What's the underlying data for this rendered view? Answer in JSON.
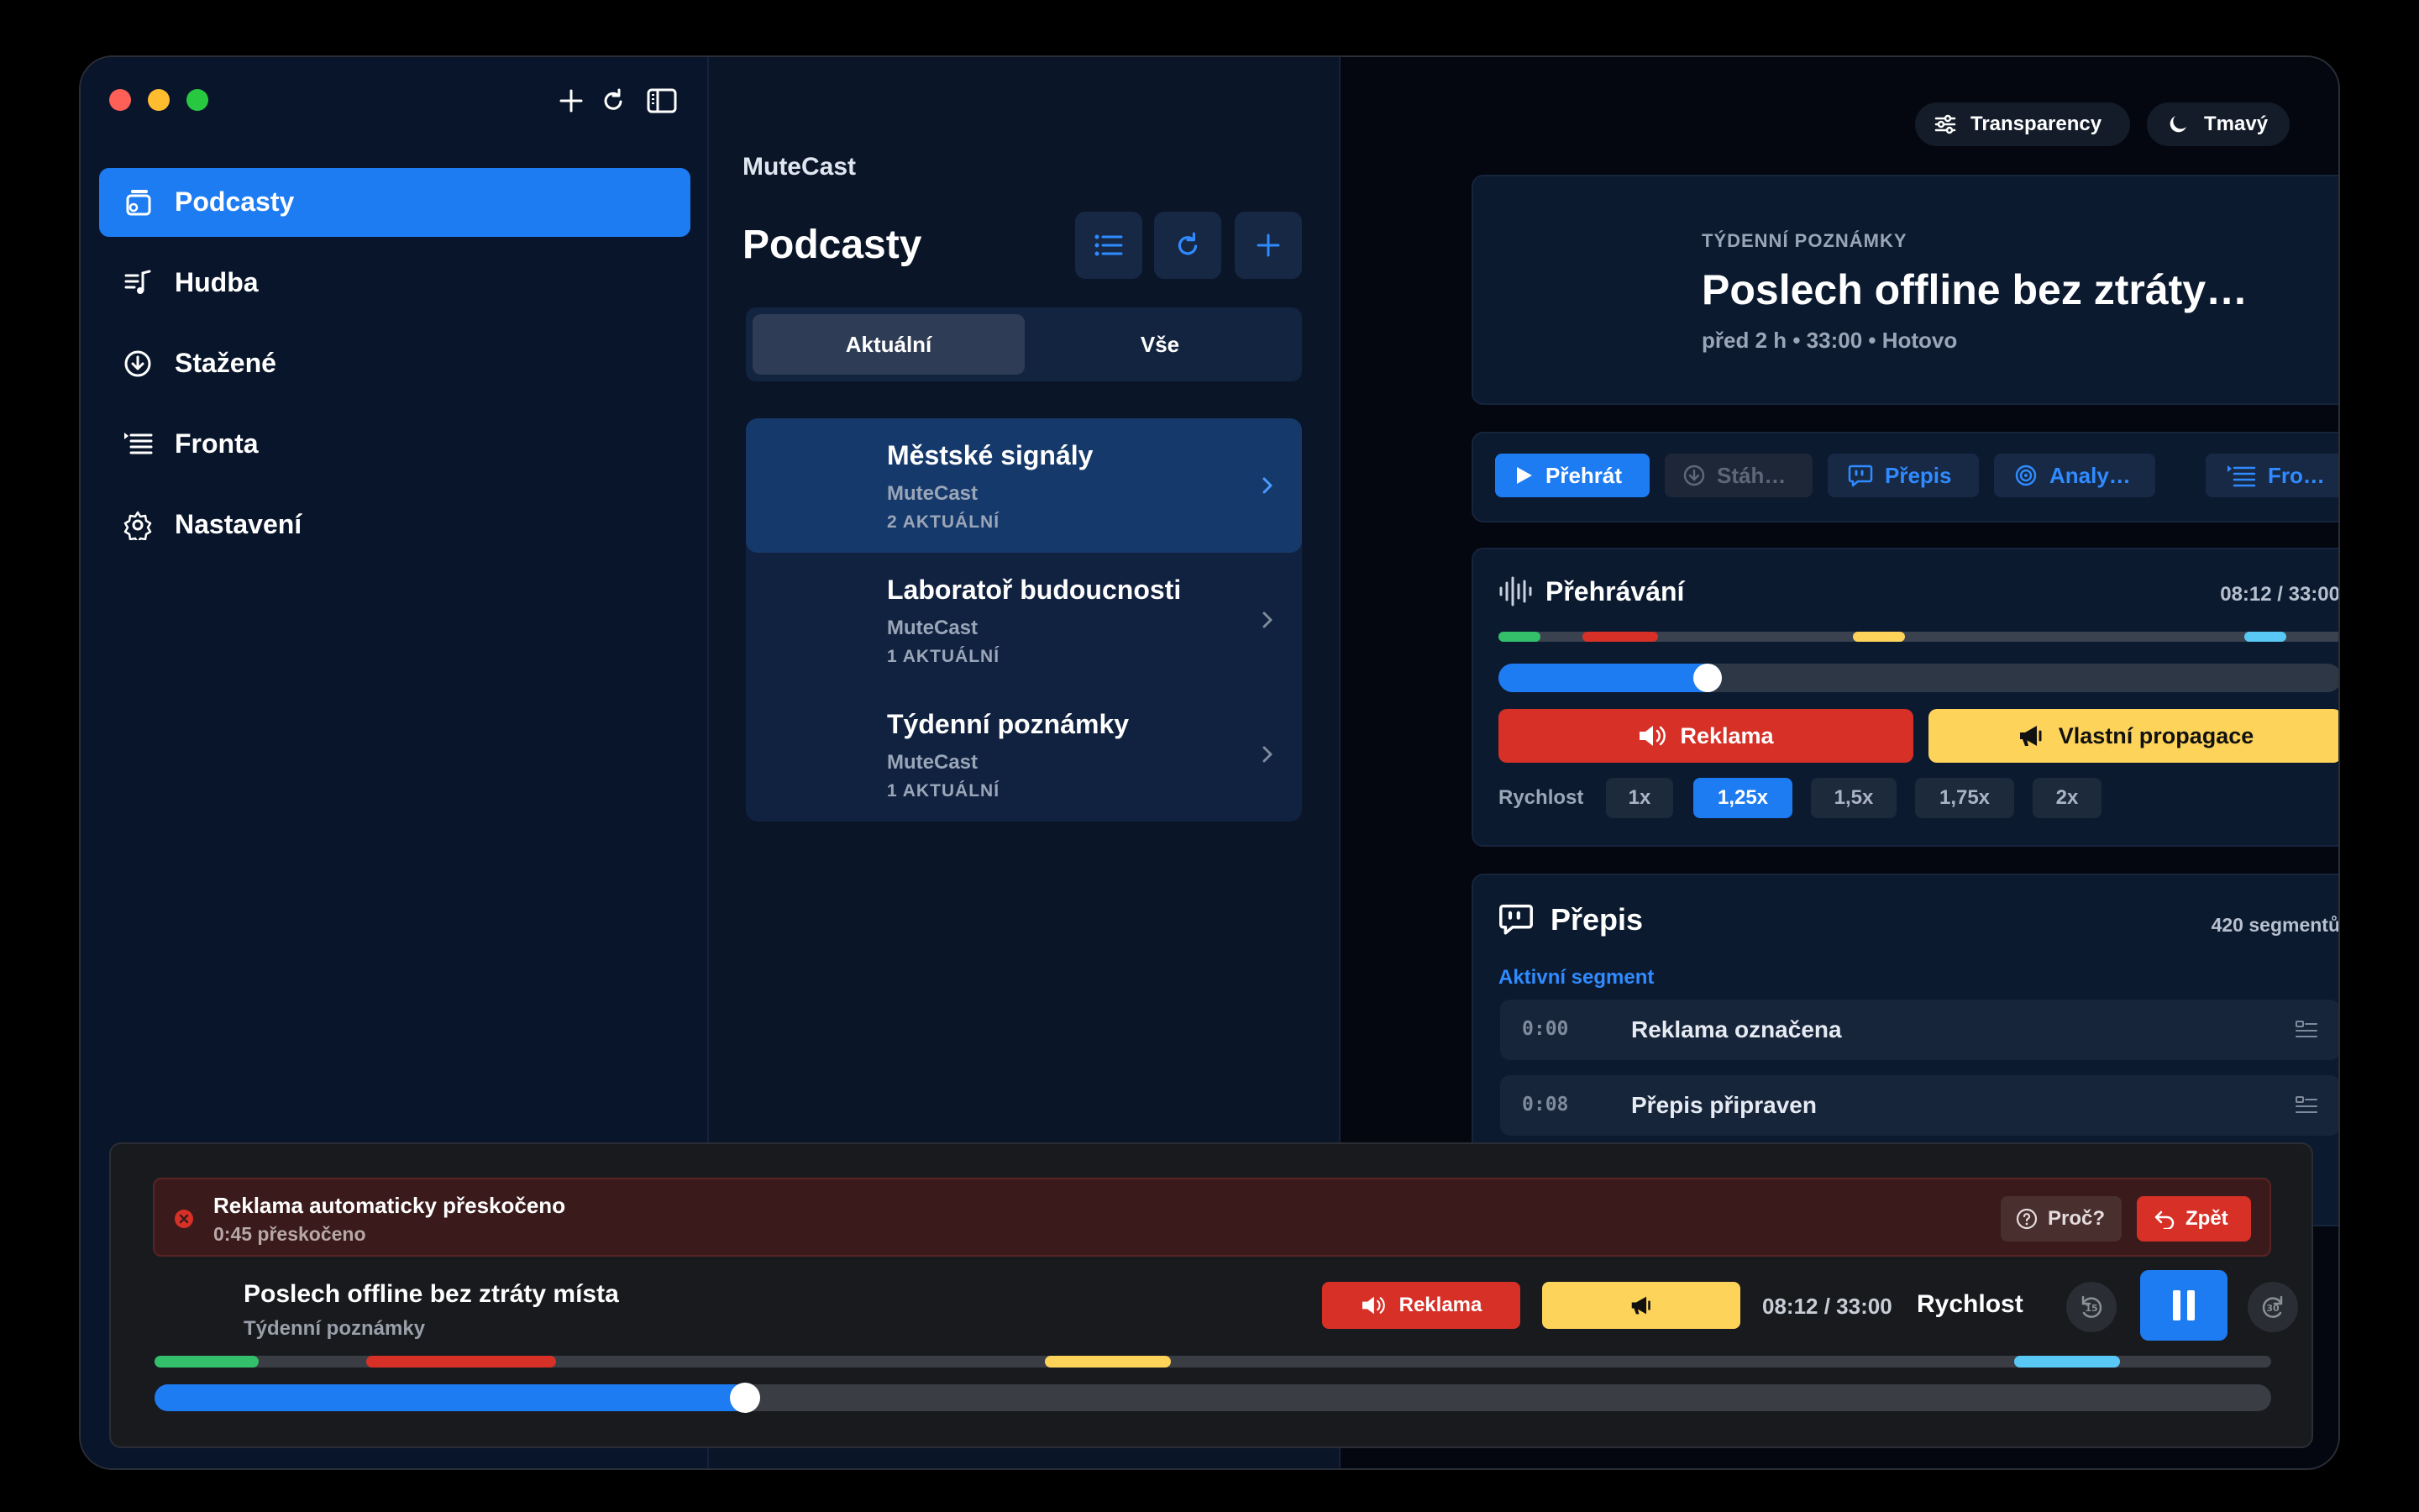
{
  "window": {
    "toolbar": {
      "new_icon": "plus-icon",
      "refresh_icon": "refresh-icon",
      "sidebar_icon": "sidebar-toggle-icon"
    }
  },
  "sidebar": {
    "items": [
      {
        "label": "Podcasty",
        "icon": "podcast-stack-icon",
        "active": true
      },
      {
        "label": "Hudba",
        "icon": "music-list-icon",
        "active": false
      },
      {
        "label": "Stažené",
        "icon": "download-circle-icon",
        "active": false
      },
      {
        "label": "Fronta",
        "icon": "queue-list-icon",
        "active": false
      },
      {
        "label": "Nastavení",
        "icon": "gear-icon",
        "active": false
      }
    ]
  },
  "middle": {
    "app_name": "MuteCast",
    "title": "Podcasty",
    "segments": {
      "current": "Aktuální",
      "all": "Vše"
    },
    "podcasts": [
      {
        "title": "Městské signály",
        "author": "MuteCast",
        "count": "2 AKTUÁLNÍ"
      },
      {
        "title": "Laboratoř budoucnosti",
        "author": "MuteCast",
        "count": "1 AKTUÁLNÍ"
      },
      {
        "title": "Týdenní poznámky",
        "author": "MuteCast",
        "count": "1 AKTUÁLNÍ"
      }
    ]
  },
  "right": {
    "pills": {
      "transparency": "Transparency",
      "theme": "Tmavý"
    },
    "episode": {
      "kicker": "TÝDENNÍ POZNÁMKY",
      "title": "Poslech offline bez ztráty…",
      "meta": "před 2 h • 33:00 • Hotovo"
    },
    "actions": {
      "play": "Přehrát",
      "download": "Stáh…",
      "transcript": "Přepis",
      "analyze": "Analy…",
      "queue": "Fro…"
    },
    "playback": {
      "title": "Přehrávání",
      "time": "08:12 / 33:00",
      "progress": 0.248,
      "ad_button": "Reklama",
      "promo_button": "Vlastní propagace",
      "speed_label": "Rychlost",
      "speeds": [
        "1x",
        "1,25x",
        "1,5x",
        "1,75x",
        "2x"
      ],
      "selected_speed": "1,25x"
    },
    "transcript": {
      "title": "Přepis",
      "count": "420 segmentů",
      "active_label": "Aktivní segment",
      "segments": [
        {
          "time": "0:00",
          "text": "Reklama označena"
        },
        {
          "time": "0:08",
          "text": "Přepis připraven"
        }
      ]
    }
  },
  "player": {
    "banner": {
      "title": "Reklama automaticky přeskočeno",
      "subtitle": "0:45 přeskočeno",
      "why": "Proč?",
      "undo": "Zpět"
    },
    "now_playing": {
      "title": "Poslech offline bez ztráty místa",
      "show": "Týdenní poznámky"
    },
    "ad_button": "Reklama",
    "time": "08:12 / 33:00",
    "speed_label": "Rychlost",
    "progress": 0.279
  },
  "colors": {
    "accent": "#1e7cf2",
    "ad": "#d63027",
    "promo": "#fdd35a",
    "sponsor_green": "#34c06a",
    "outro_cyan": "#5ac8f5"
  }
}
